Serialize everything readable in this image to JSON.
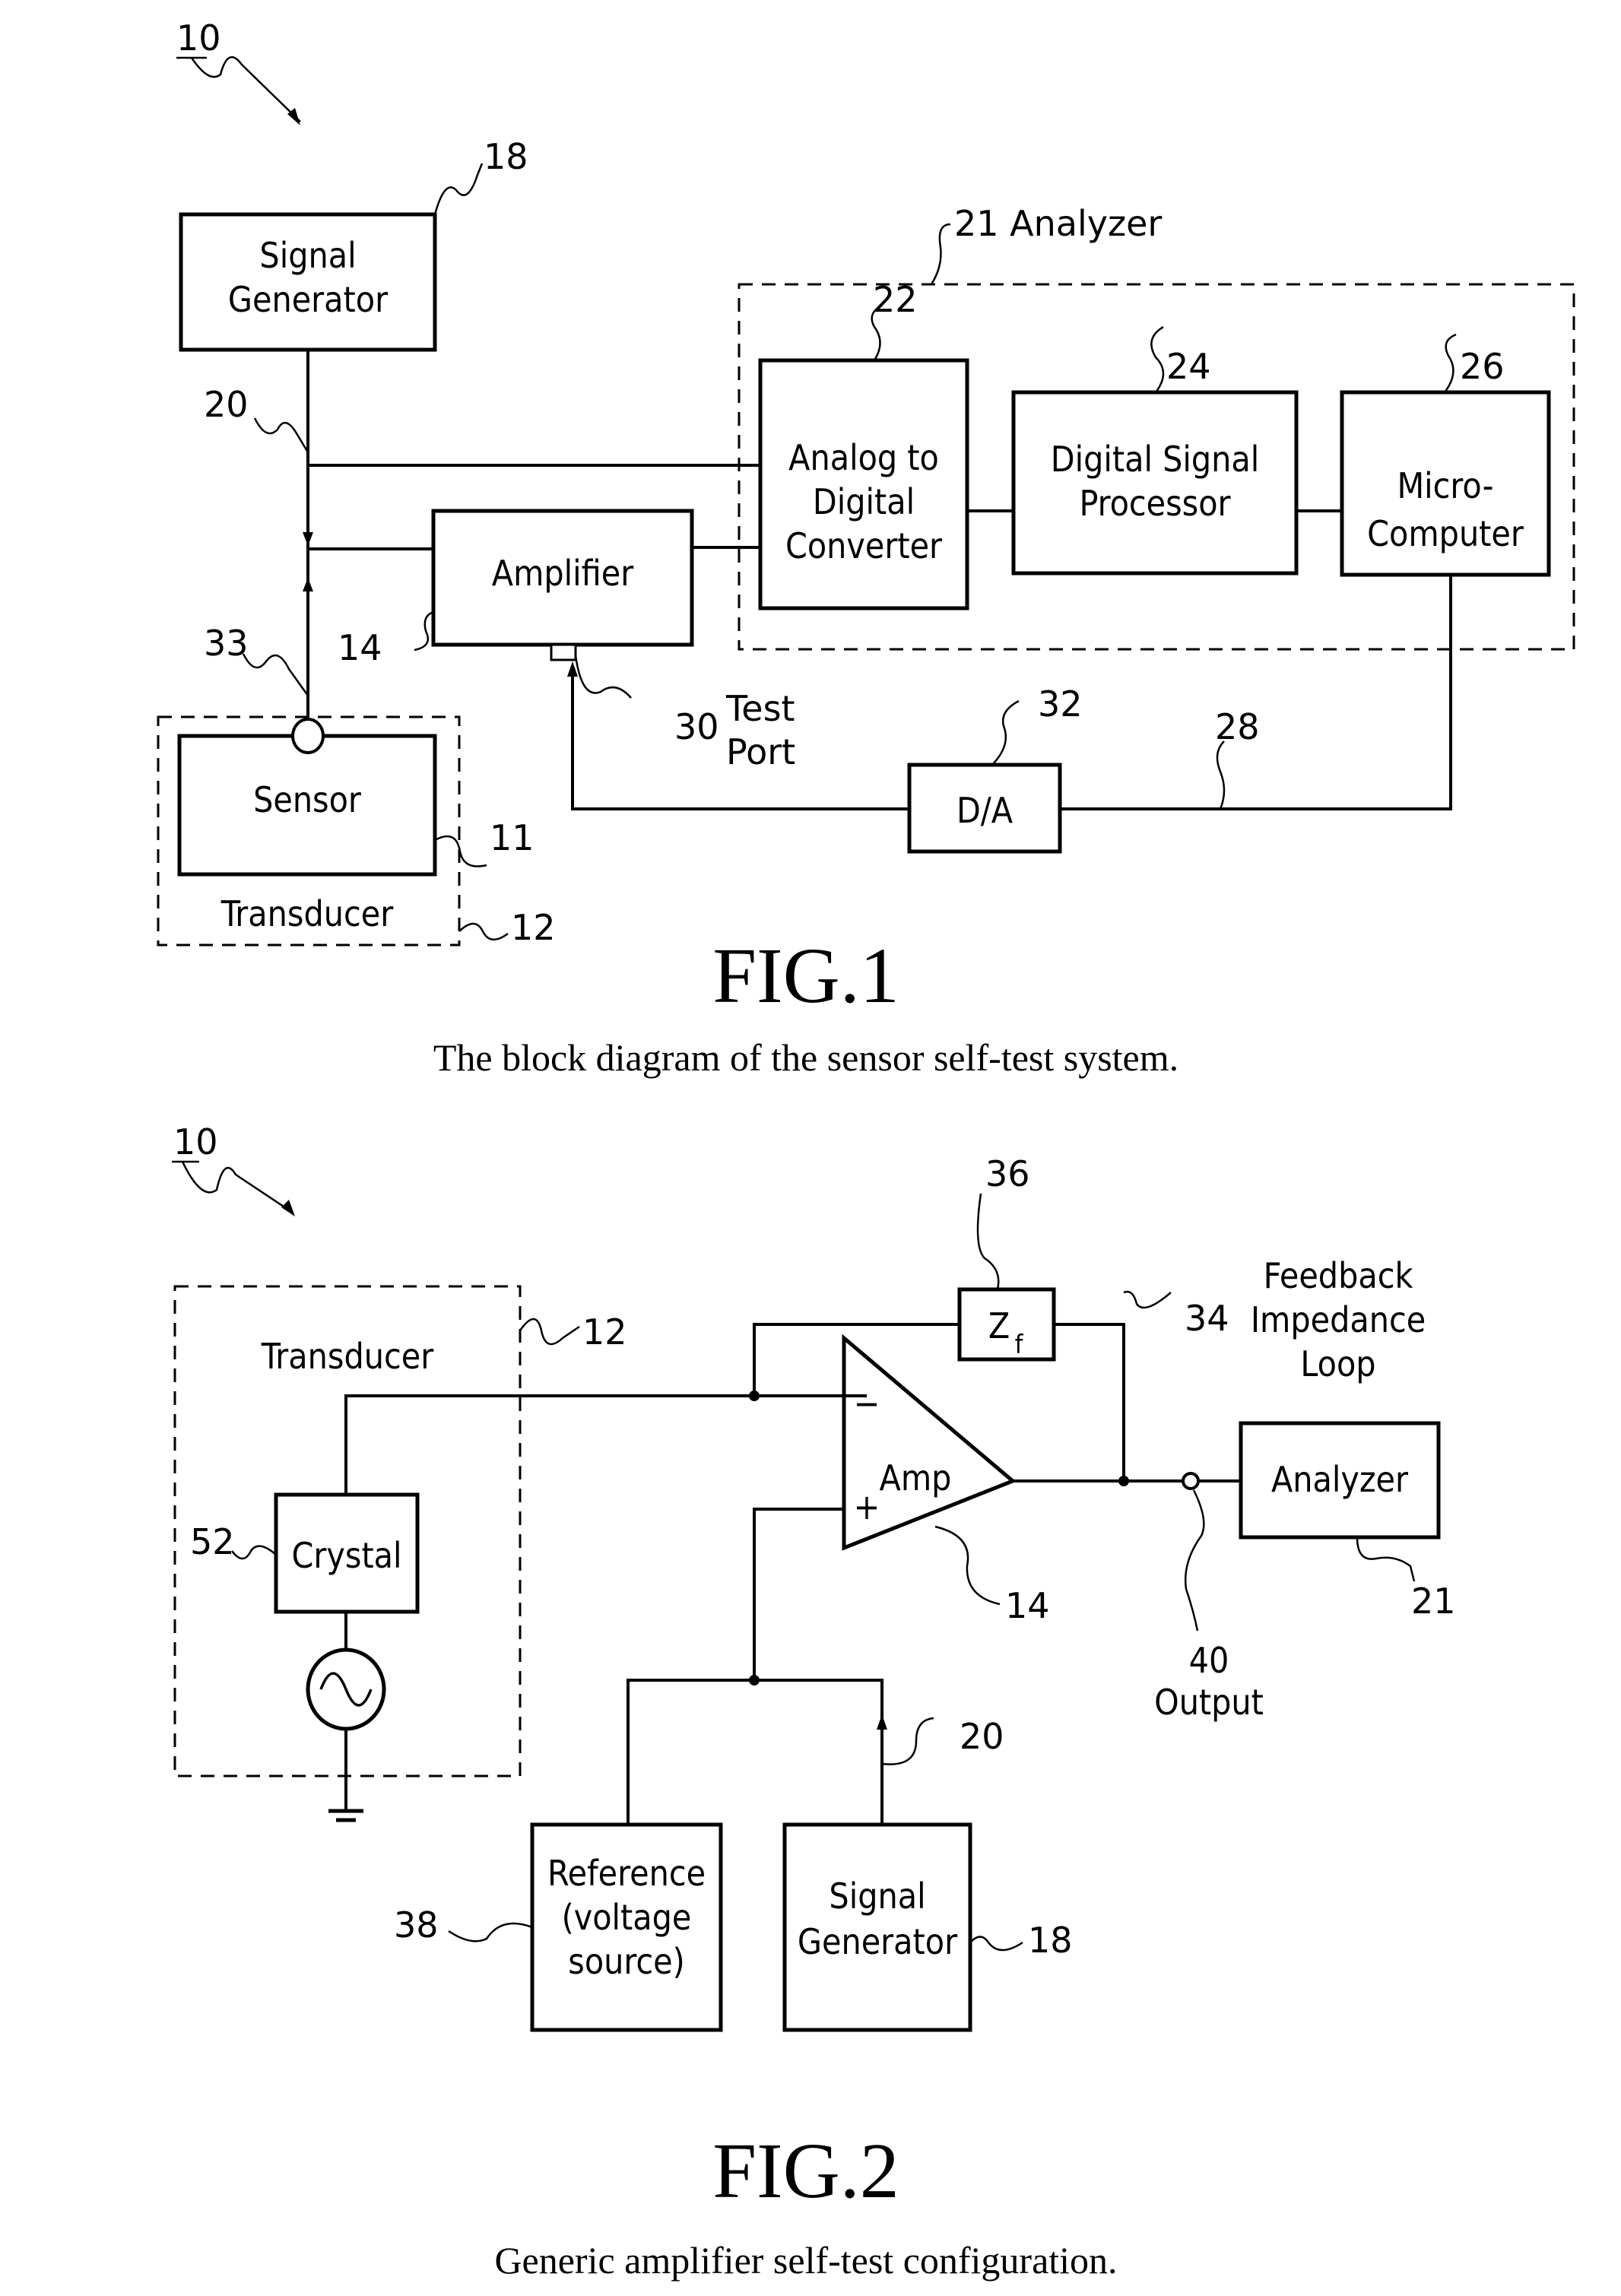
{
  "figures": [
    {
      "id": "fig1",
      "title": "FIG.1",
      "caption": "The block diagram of the sensor self-test system.",
      "system_ref": "10",
      "blocks": {
        "signal_generator": {
          "lines": [
            "Signal",
            "Generator"
          ],
          "ref": "18"
        },
        "adc": {
          "lines": [
            "Analog to",
            "Digital",
            "Converter"
          ],
          "ref": "22"
        },
        "dsp": {
          "lines": [
            "Digital Signal",
            "Processor"
          ],
          "ref": "24"
        },
        "microcomputer": {
          "lines": [
            "Micro-",
            "Computer"
          ],
          "ref": "26"
        },
        "amplifier": {
          "lines": [
            "Amplifier"
          ],
          "ref": "14"
        },
        "sensor": {
          "lines": [
            "Sensor"
          ],
          "ref": "11"
        },
        "da": {
          "lines": [
            "D/A"
          ],
          "ref": "32"
        }
      },
      "groups": {
        "analyzer": {
          "label": "21 Analyzer"
        },
        "transducer": {
          "label": "Transducer",
          "ref": "12"
        }
      },
      "refs": {
        "signal_line": "20",
        "sensor_line": "33",
        "test_port": "30",
        "test_port_label": [
          "Test",
          "Port"
        ],
        "feedback_line": "28"
      }
    },
    {
      "id": "fig2",
      "title": "FIG.2",
      "caption": "Generic amplifier self-test configuration.",
      "system_ref": "10",
      "blocks": {
        "crystal": {
          "lines": [
            "Crystal"
          ],
          "ref": "52"
        },
        "zf": {
          "main": "Z",
          "sub": "f",
          "ref": "36"
        },
        "amp": {
          "lines": [
            "Amp"
          ],
          "ref": "14",
          "minus": "−",
          "plus": "+"
        },
        "analyzer": {
          "lines": [
            "Analyzer"
          ],
          "ref": "21"
        },
        "reference": {
          "lines": [
            "Reference",
            "(voltage",
            "source)"
          ],
          "ref": "38"
        },
        "signal_generator": {
          "lines": [
            "Signal",
            "Generator"
          ],
          "ref": "18"
        }
      },
      "groups": {
        "transducer": {
          "label": "Transducer",
          "ref": "12"
        }
      },
      "refs": {
        "feedback_loop": "34",
        "feedback_label": [
          "Feedback",
          "Impedance",
          "Loop"
        ],
        "output": "40",
        "output_label": "Output",
        "signal_line": "20"
      }
    }
  ]
}
